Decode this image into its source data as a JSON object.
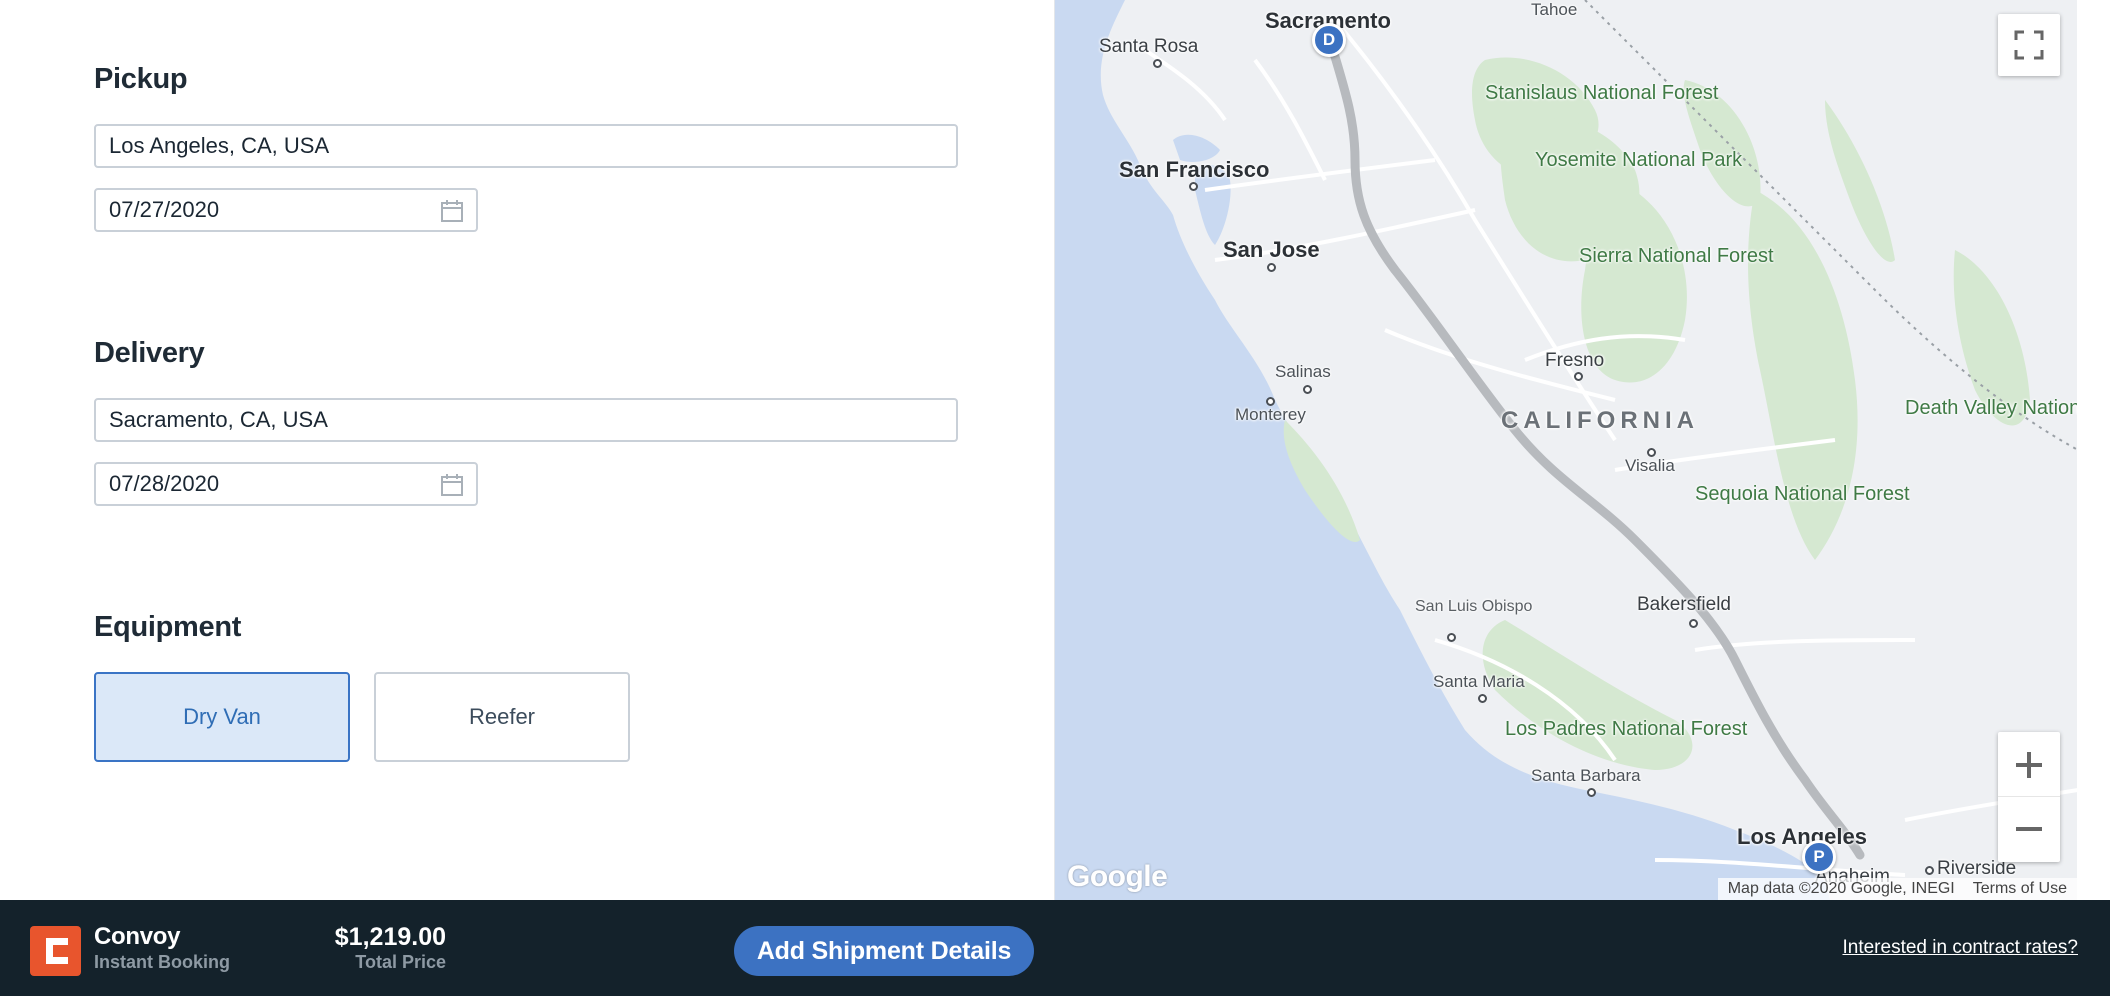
{
  "pickup": {
    "title": "Pickup",
    "location": "Los Angeles, CA, USA",
    "date": "07/27/2020"
  },
  "delivery": {
    "title": "Delivery",
    "location": "Sacramento, CA, USA",
    "date": "07/28/2020"
  },
  "equipment": {
    "title": "Equipment",
    "options": [
      {
        "label": "Dry Van",
        "selected": true
      },
      {
        "label": "Reefer",
        "selected": false
      }
    ]
  },
  "map": {
    "cities": {
      "sacramento": "Sacramento",
      "santa_rosa": "Santa Rosa",
      "tahoe": "Tahoe",
      "san_francisco": "San Francisco",
      "san_jose": "San Jose",
      "salinas": "Salinas",
      "monterey": "Monterey",
      "fresno": "Fresno",
      "visalia": "Visalia",
      "bakersfield": "Bakersfield",
      "san_luis_obispo": "San Luis Obispo",
      "santa_maria": "Santa Maria",
      "santa_barbara": "Santa Barbara",
      "los_angeles": "Los Angeles",
      "anaheim": "Anaheim",
      "riverside": "Riverside"
    },
    "parks": {
      "stanislaus": "Stanislaus National Forest",
      "yosemite": "Yosemite National Park",
      "sierra": "Sierra National Forest",
      "death_valley": "Death Valley National Park",
      "sequoia": "Sequoia National Forest",
      "los_padres": "Los Padres National Forest"
    },
    "state_label": "CALIFORNIA",
    "markers": {
      "delivery": "D",
      "pickup": "P"
    },
    "logo": "Google",
    "attribution": "Map data ©2020 Google, INEGI",
    "terms": "Terms of Use",
    "colors": {
      "water": "#c9d9f1",
      "land": "#eef0f3",
      "park": "#d5e8d1",
      "route": "#b7babe",
      "marker": "#3c72c2"
    }
  },
  "footer": {
    "brand_name": "Convoy",
    "brand_sub": "Instant Booking",
    "price": "$1,219.00",
    "price_label": "Total Price",
    "primary_action": "Add Shipment Details",
    "contract_link": "Interested in contract rates?",
    "brand_color": "#e8552d",
    "bar_color": "#14222b"
  }
}
